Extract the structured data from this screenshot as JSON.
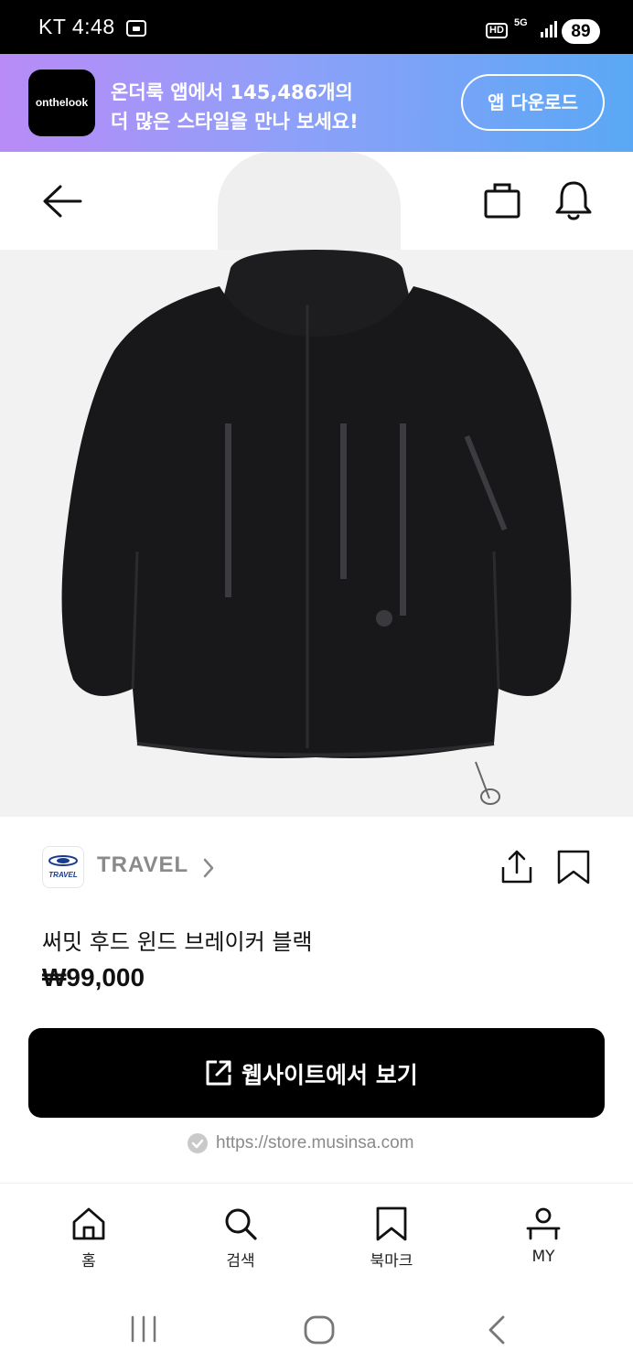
{
  "status_bar": {
    "carrier_time": "KT 4:48",
    "hd": "HD",
    "network": "5G",
    "battery": "89"
  },
  "banner": {
    "logo_text": "onthelook",
    "line1": "온더룩 앱에서 145,486개의",
    "line2": "더 많은 스타일을 만나 보세요!",
    "download_label": "앱 다운로드"
  },
  "product": {
    "brand": "TRAVEL",
    "brand_logo_text": "TRAVEL",
    "title": "써밋 후드 윈드 브레이커 블랙",
    "price": "₩99,000",
    "cta_label": "웹사이트에서 보기",
    "source_url": "https://store.musinsa.com"
  },
  "bottom_nav": [
    {
      "label": "홈",
      "icon": "home-icon"
    },
    {
      "label": "검색",
      "icon": "search-icon"
    },
    {
      "label": "북마크",
      "icon": "bookmark-icon"
    },
    {
      "label": "MY",
      "icon": "person-icon"
    }
  ],
  "colors": {
    "banner_gradient_start": "#b98bf7",
    "banner_gradient_end": "#5aa8f5",
    "cta_background": "#000000",
    "muted_text": "#8a8a8a"
  }
}
